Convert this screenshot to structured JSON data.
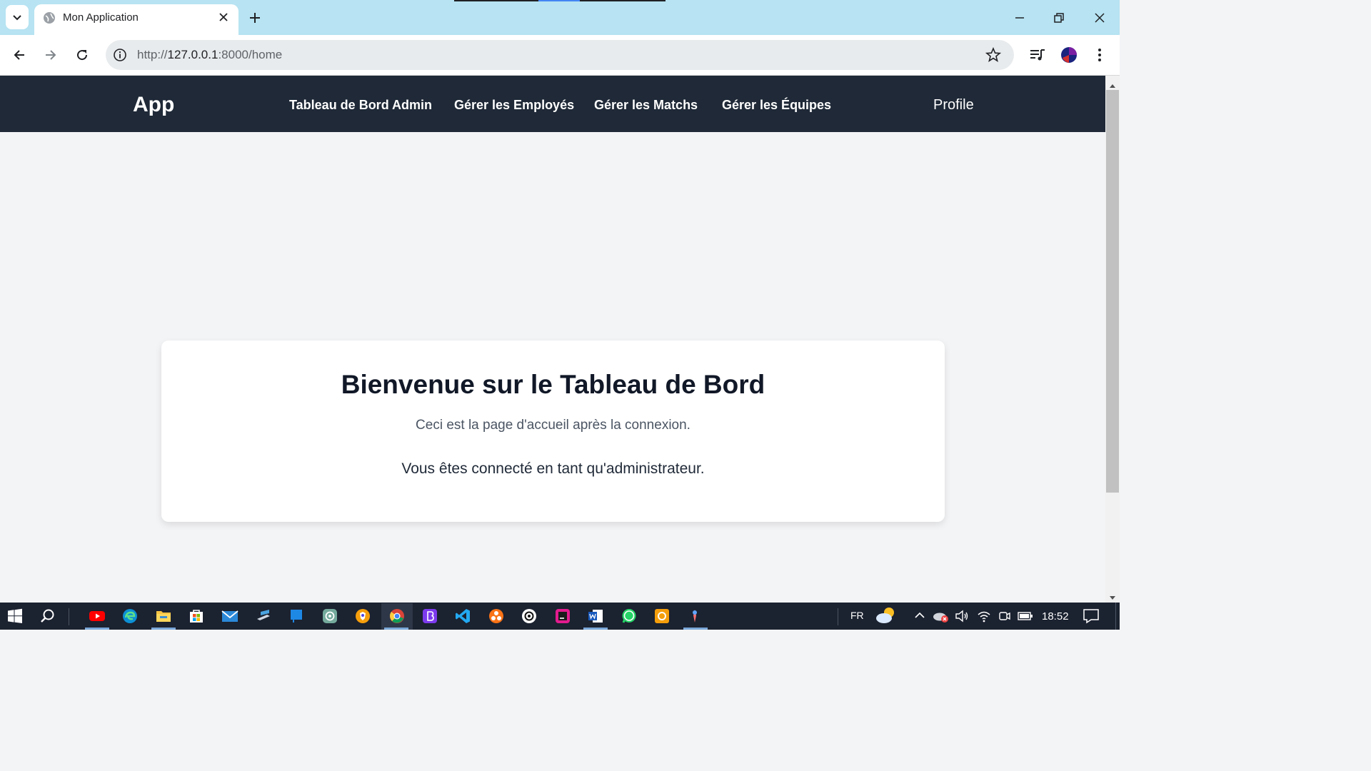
{
  "browser": {
    "tab_title": "Mon Application",
    "url_host": "127.0.0.1",
    "url_prefix": "http://",
    "url_rest": ":8000/home"
  },
  "app": {
    "brand": "App",
    "nav": [
      {
        "label": "Tableau de Bord Admin"
      },
      {
        "label": "Gérer les Employés"
      },
      {
        "label": "Gérer les Matchs"
      },
      {
        "label": "Gérer les Équipes"
      }
    ],
    "profile": "Profile"
  },
  "card": {
    "title": "Bienvenue sur le Tableau de Bord",
    "subtitle": "Ceci est la page d'accueil après la connexion.",
    "role": "Vous êtes connecté en tant qu'administrateur."
  },
  "taskbar": {
    "language": "FR",
    "time": "18:52"
  },
  "colors": {
    "nav_bg": "#1f2937",
    "page_bg": "#f3f4f6",
    "tabstrip": "#b7e3f2"
  }
}
